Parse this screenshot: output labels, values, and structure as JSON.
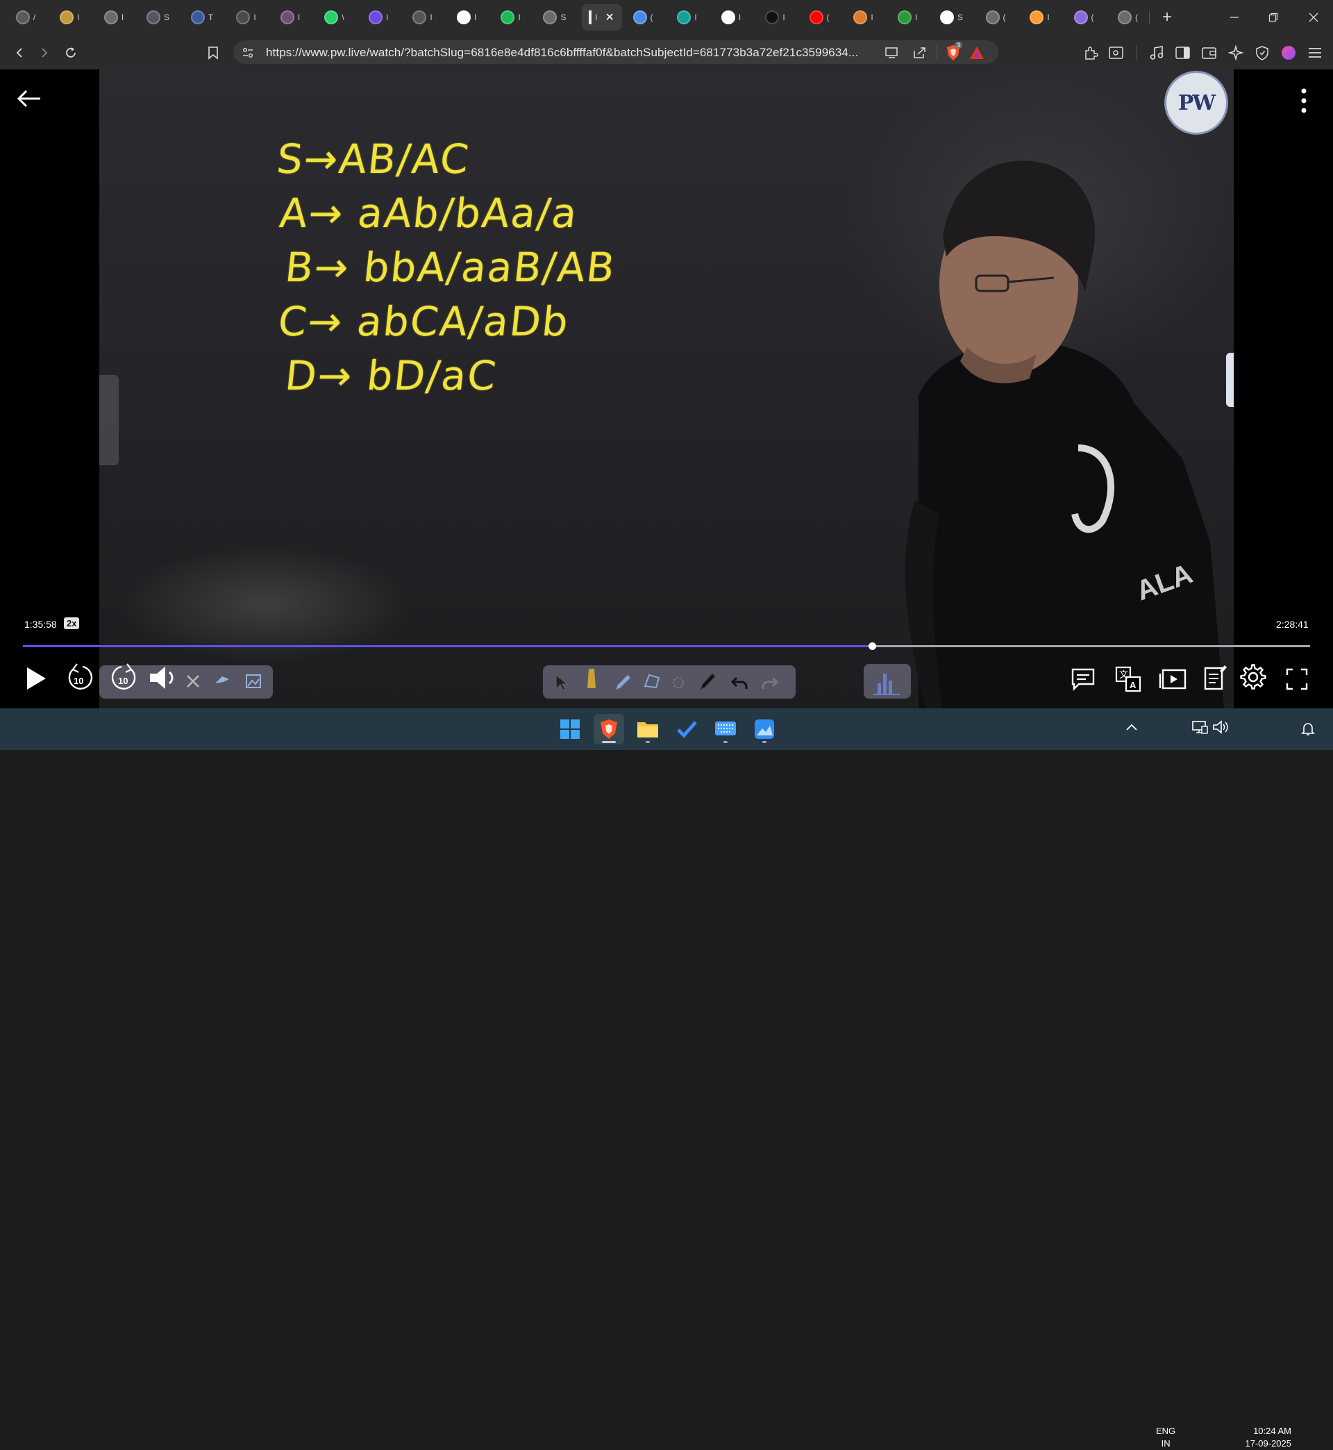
{
  "browser": {
    "tabs": [
      {
        "icon": "chatgpt-icon",
        "text": "/",
        "color": "#5a5a5a"
      },
      {
        "icon": "coin-icon",
        "text": "I",
        "color": "#c39a3a"
      },
      {
        "icon": "globe-icon",
        "text": "I",
        "color": "#6b6b6b"
      },
      {
        "icon": "site-icon",
        "text": "S",
        "color": "#556"
      },
      {
        "icon": "w3-icon",
        "text": "T",
        "color": "#3a5a9a"
      },
      {
        "icon": "site-icon",
        "text": "I",
        "color": "#4a4a4a"
      },
      {
        "icon": "avatar-icon",
        "text": "I",
        "color": "#6d4e7a"
      },
      {
        "icon": "whatsapp-icon",
        "text": "\\",
        "color": "#25d366"
      },
      {
        "icon": "bookmark-icon",
        "text": "I",
        "color": "#6a4adf"
      },
      {
        "icon": "oclp-icon",
        "text": "I",
        "color": "#555"
      },
      {
        "icon": "google-icon",
        "text": "I",
        "color": "#ffffff"
      },
      {
        "icon": "spotify-icon",
        "text": "I",
        "color": "#1db954"
      },
      {
        "icon": "globe-icon",
        "text": "S",
        "color": "#6b6b6b"
      },
      {
        "icon": "active-tab",
        "text": "I",
        "color": "#3d3d3d"
      },
      {
        "icon": "gemini-icon",
        "text": "(",
        "color": "#4a8ae8"
      },
      {
        "icon": "pw-icon",
        "text": "I",
        "color": "#14a098"
      },
      {
        "icon": "google-icon",
        "text": "I",
        "color": "#ffffff"
      },
      {
        "icon": "screen-icon",
        "text": "I",
        "color": "#111"
      },
      {
        "icon": "youtube-icon",
        "text": "(",
        "color": "#ff0000"
      },
      {
        "icon": "basketball-icon",
        "text": "I",
        "color": "#e07a2a"
      },
      {
        "icon": "chart-icon",
        "text": "I",
        "color": "#2a9a3a"
      },
      {
        "icon": "wikipedia-icon",
        "text": "S",
        "color": "#ffffff"
      },
      {
        "icon": "globe-icon",
        "text": "(",
        "color": "#6b6b6b"
      },
      {
        "icon": "flag-icon",
        "text": "I",
        "color": "#ff9933"
      },
      {
        "icon": "circle-icon",
        "text": "(",
        "color": "#8a6ad8"
      },
      {
        "icon": "globe-icon",
        "text": "(",
        "color": "#6b6b6b"
      }
    ],
    "new_tab": "+",
    "url": "https://www.pw.live/watch/?batchSlug=6816e8e4df816c6bffffaf0f&batchSubjectId=681773b3a72ef21c3599634...",
    "brave_badge": "3"
  },
  "video": {
    "board_lines": [
      "S→AB/AC",
      "A→ aAb/bAa/a",
      "B→ bbA/aaB/AB",
      "C→ abCA/aDb",
      "D→ bD/aC"
    ],
    "logo_text": "PW",
    "shirt_text": "ALA",
    "current_time": "1:35:58",
    "speed": "2x",
    "total_time": "2:28:41",
    "progress_fraction": 0.6594
  },
  "taskbar": {
    "lang_line1": "ENG",
    "lang_line2": "IN",
    "time": "10:24 AM",
    "date": "17-09-2025"
  }
}
